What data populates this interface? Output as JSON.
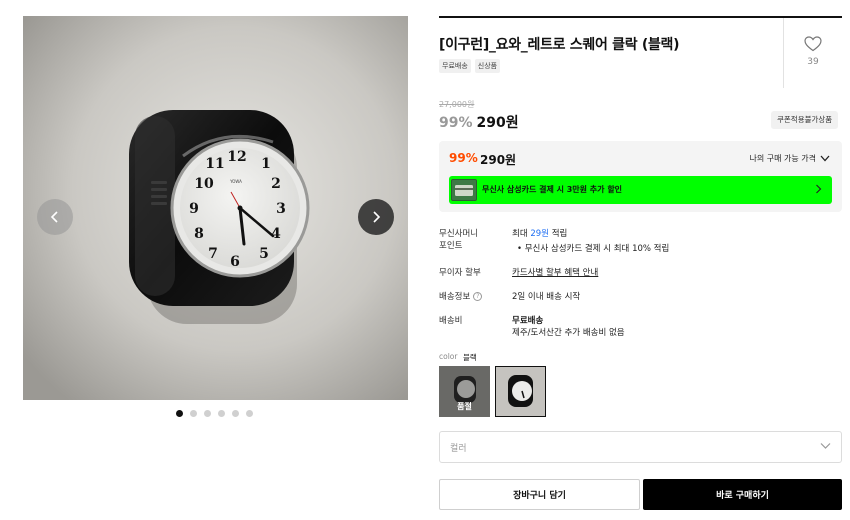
{
  "gallery": {
    "dot_count": 6,
    "active_dot": 0
  },
  "product": {
    "title": "[이구런]_요와_레트로 스퀘어 클락 (블랙)",
    "tags": [
      "무료배송",
      "신상품"
    ],
    "likes": "39",
    "original_price": "27,000원",
    "discount": "99%",
    "price": "290원",
    "coupon_label": "쿠폰적용불가상품"
  },
  "my_price": {
    "discount": "99%",
    "price": "290원",
    "link_label": "나의 구매 가능 가격",
    "promo_text": "무신사 삼성카드 결제 시 3만원 추가 할인"
  },
  "info": {
    "points_label_1": "무신사머니",
    "points_label_2": "포인트",
    "points_value_prefix": "최대",
    "points_value_amount": "29원",
    "points_value_suffix": "적립",
    "points_sub": "무신사 삼성카드 결제 시 최대 10% 적립",
    "installment_label": "무이자 할부",
    "installment_value": "카드사별 할부 혜택 안내",
    "shipping_info_label": "배송정보",
    "shipping_info_value": "2일 이내 배송 시작",
    "shipping_fee_label": "배송비",
    "shipping_fee_value": "무료배송",
    "shipping_fee_sub": "제주/도서산간 추가 배송비 없음"
  },
  "option": {
    "label": "color",
    "value": "블랙",
    "soldout_label": "품절",
    "select_placeholder": "컬러"
  },
  "actions": {
    "cart": "장바구니 담기",
    "buy": "바로 구매하기"
  },
  "colors": {
    "accent_orange": "#ff4c00",
    "promo_green": "#00ff00",
    "link_blue": "#1f6ff3"
  },
  "icons": [
    "chevron-left-icon",
    "chevron-right-icon",
    "heart-icon",
    "chevron-down-icon",
    "help-icon",
    "card-icon"
  ]
}
